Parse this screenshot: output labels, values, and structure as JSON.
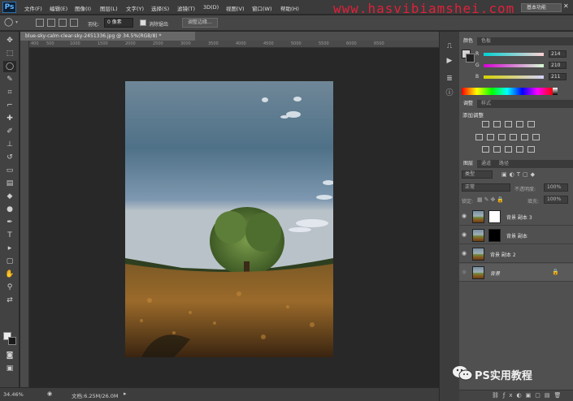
{
  "app": {
    "logo": "Ps",
    "watermark": "www.hasvibiamshei.com"
  },
  "menu": [
    "文件(F)",
    "编辑(E)",
    "图像(I)",
    "图层(L)",
    "文字(Y)",
    "选择(S)",
    "滤镜(T)",
    "3D(D)",
    "视图(V)",
    "窗口(W)",
    "帮助(H)"
  ],
  "workspace": {
    "label": "基本功能"
  },
  "options": {
    "feather_label": "羽化:",
    "feather_value": "0 像素",
    "antialias_label": "消除锯齿",
    "refine_edge": "调整边缘..."
  },
  "document": {
    "tab_title": "blue-sky-calm-clear-sky-2451336.jpg @ 34.5%(RGB/8) *",
    "zoom": "34.46%",
    "docsize": "文档:6.25M/26.0M"
  },
  "rulers": {
    "h": [
      "400",
      "500",
      "1000",
      "1500",
      "2000",
      "2500",
      "3000",
      "3500",
      "4000",
      "4500",
      "5000",
      "5500",
      "6000",
      "6500"
    ]
  },
  "color_panel": {
    "tabs": [
      "颜色",
      "色板"
    ],
    "channels": [
      {
        "label": "R",
        "value": "214"
      },
      {
        "label": "G",
        "value": "210"
      },
      {
        "label": "B",
        "value": "211"
      }
    ]
  },
  "adjust_panel": {
    "tabs": [
      "调整",
      "样式"
    ],
    "title": "添加调整"
  },
  "layers_panel": {
    "tabs": [
      "图层",
      "通道",
      "路径"
    ],
    "filter_kind": "类型",
    "blend_mode": "正常",
    "opacity_label": "不透明度:",
    "opacity_value": "100%",
    "lock_label": "锁定:",
    "fill_label": "填充:",
    "fill_value": "100%",
    "layers": [
      {
        "name": "背景 副本 3",
        "has_mask": true
      },
      {
        "name": "背景 副本",
        "has_mask": true
      },
      {
        "name": "背景 副本 2",
        "has_mask": false
      },
      {
        "name": "背景",
        "has_mask": false
      }
    ]
  },
  "brand": {
    "text": "PS实用教程"
  }
}
